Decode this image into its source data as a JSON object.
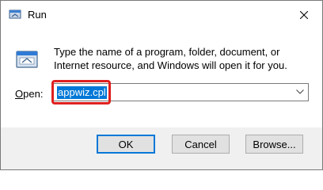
{
  "window": {
    "title": "Run",
    "app_icon": "run-icon",
    "close_icon": "close-icon"
  },
  "body": {
    "description": "Type the name of a program, folder, document, or Internet resource, and Windows will open it for you.",
    "open_label_mnemonic": "O",
    "open_label_rest": "pen:",
    "open_value": "appwiz.cpl"
  },
  "buttons": {
    "ok": "OK",
    "cancel": "Cancel",
    "browse": "Browse..."
  },
  "colors": {
    "selection": "#0078d7",
    "highlight_box": "#e02020",
    "footer_bg": "#f0f0f0"
  }
}
